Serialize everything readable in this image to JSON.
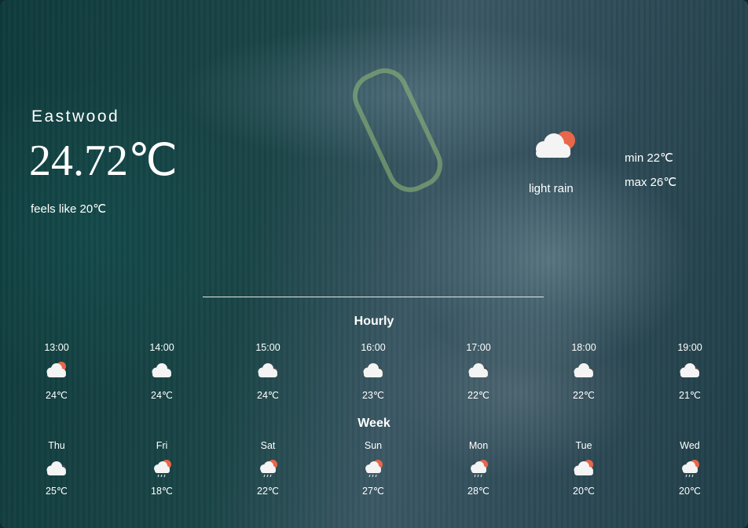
{
  "location": {
    "city": "Eastwood"
  },
  "current": {
    "temperature": "24.72℃",
    "feels_like": "feels like 20℃",
    "condition": "light rain",
    "icon": "cloud-sun-icon",
    "min": "min 22℃",
    "max": "max 26℃"
  },
  "hourly": {
    "title": "Hourly",
    "items": [
      {
        "time": "13:00",
        "icon": "cloud-sun-icon",
        "temp": "24℃"
      },
      {
        "time": "14:00",
        "icon": "cloud-icon",
        "temp": "24℃"
      },
      {
        "time": "15:00",
        "icon": "clouds-icon",
        "temp": "24℃"
      },
      {
        "time": "16:00",
        "icon": "clouds-icon",
        "temp": "23℃"
      },
      {
        "time": "17:00",
        "icon": "clouds-icon",
        "temp": "22℃"
      },
      {
        "time": "18:00",
        "icon": "clouds-icon",
        "temp": "22℃"
      },
      {
        "time": "19:00",
        "icon": "clouds-icon",
        "temp": "21℃"
      }
    ]
  },
  "week": {
    "title": "Week",
    "items": [
      {
        "day": "Thu",
        "icon": "clouds-icon",
        "temp": "25℃"
      },
      {
        "day": "Fri",
        "icon": "rain-sun-icon",
        "temp": "18℃"
      },
      {
        "day": "Sat",
        "icon": "rain-sun-icon",
        "temp": "22℃"
      },
      {
        "day": "Sun",
        "icon": "rain-sun-icon",
        "temp": "27℃"
      },
      {
        "day": "Mon",
        "icon": "rain-sun-icon",
        "temp": "28℃"
      },
      {
        "day": "Tue",
        "icon": "cloud-sun-icon",
        "temp": "20℃"
      },
      {
        "day": "Wed",
        "icon": "rain-sun-icon",
        "temp": "20℃"
      }
    ]
  },
  "colors": {
    "sun": "#e8674a",
    "cloud": "#f4f4f4",
    "dark_cloud": "#4a4a4a"
  }
}
